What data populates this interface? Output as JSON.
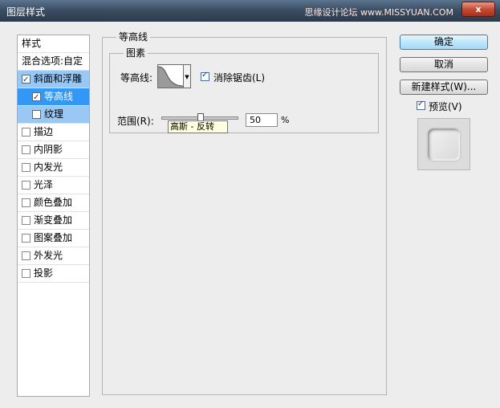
{
  "window": {
    "title": "图层样式",
    "watermark": "思缘设计论坛 www.MISSYUAN.COM",
    "close_label": "x"
  },
  "sidebar": {
    "header": "样式",
    "items": [
      {
        "label": "混合选项:自定",
        "checkbox": false,
        "checked": false,
        "state": "normal"
      },
      {
        "label": "斜面和浮雕",
        "checkbox": true,
        "checked": true,
        "state": "sub"
      },
      {
        "label": "等高线",
        "checkbox": true,
        "checked": true,
        "state": "selected"
      },
      {
        "label": "纹理",
        "checkbox": true,
        "checked": false,
        "state": "sub"
      },
      {
        "label": "描边",
        "checkbox": true,
        "checked": false,
        "state": "normal"
      },
      {
        "label": "内阴影",
        "checkbox": true,
        "checked": false,
        "state": "normal"
      },
      {
        "label": "内发光",
        "checkbox": true,
        "checked": false,
        "state": "normal"
      },
      {
        "label": "光泽",
        "checkbox": true,
        "checked": false,
        "state": "normal"
      },
      {
        "label": "颜色叠加",
        "checkbox": true,
        "checked": false,
        "state": "normal"
      },
      {
        "label": "渐变叠加",
        "checkbox": true,
        "checked": false,
        "state": "normal"
      },
      {
        "label": "图案叠加",
        "checkbox": true,
        "checked": false,
        "state": "normal"
      },
      {
        "label": "外发光",
        "checkbox": true,
        "checked": false,
        "state": "normal"
      },
      {
        "label": "投影",
        "checkbox": true,
        "checked": false,
        "state": "normal"
      }
    ]
  },
  "main": {
    "group_title": "等高线",
    "subgroup_title": "图素",
    "contour_label": "等高线:",
    "antialias_label": "消除锯齿(L)",
    "antialias_checked": true,
    "range_label": "范围(R):",
    "range_value": "50",
    "range_unit": "%",
    "range_fraction": 0.5,
    "tooltip": "高斯 - 反转"
  },
  "buttons": {
    "ok": "确定",
    "cancel": "取消",
    "new_style": "新建样式(W)...",
    "preview_label": "预览(V)",
    "preview_checked": true
  }
}
